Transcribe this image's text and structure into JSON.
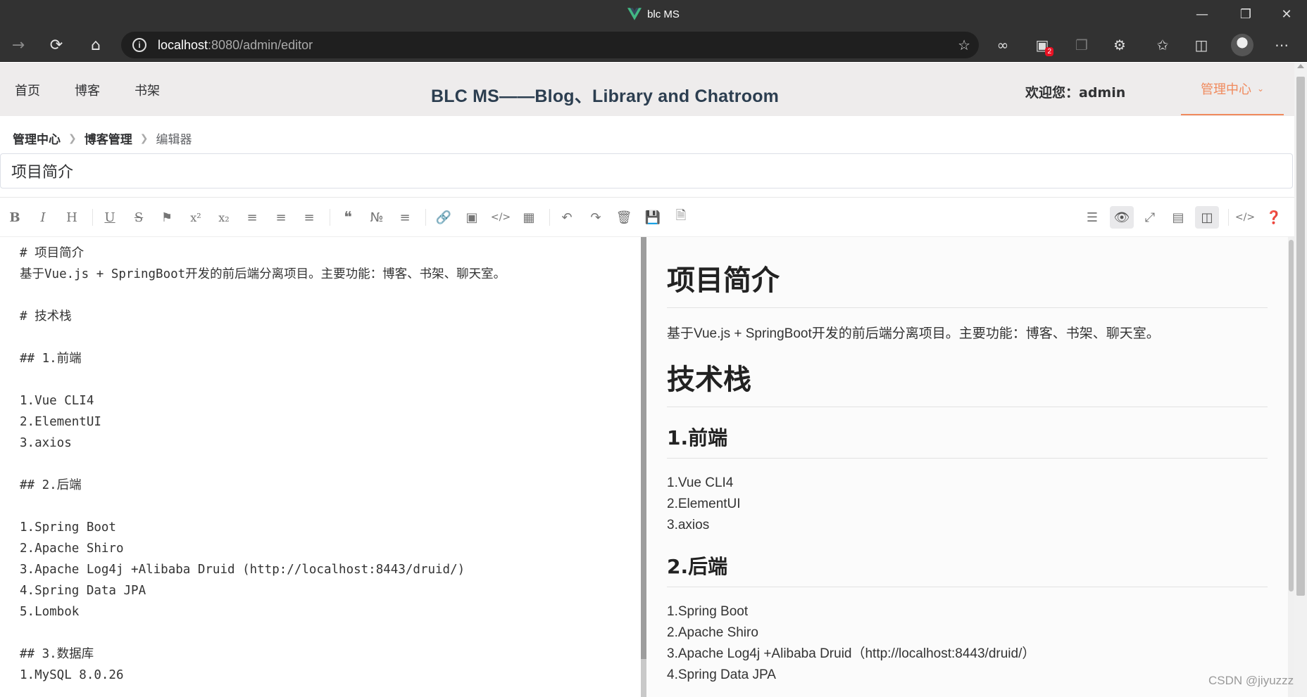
{
  "browser": {
    "window_title": "blc MS",
    "url_host": "localhost",
    "url_rest": ":8080/admin/editor",
    "extension_badge": "2",
    "accent": "#42b883"
  },
  "header": {
    "nav": [
      "首页",
      "博客",
      "书架"
    ],
    "title": "BLC MS——Blog、Library and Chatroom",
    "welcome": "欢迎您：admin",
    "admin_menu": "管理中心",
    "accent": "#f08a5d"
  },
  "breadcrumb": [
    "管理中心",
    "博客管理",
    "编辑器"
  ],
  "article": {
    "title": "项目简介"
  },
  "editor": {
    "source_lines": [
      "# 项目简介",
      "基于Vue.js + SpringBoot开发的前后端分离项目。主要功能：博客、书架、聊天室。",
      "",
      "# 技术栈",
      "",
      "## 1.前端",
      "",
      "1.Vue CLI4",
      "2.ElementUI",
      "3.axios",
      "",
      "## 2.后端",
      "",
      "1.Spring Boot",
      "2.Apache Shiro",
      "3.Apache Log4j +Alibaba Druid (http://localhost:8443/druid/)",
      "4.Spring Data JPA",
      "5.Lombok",
      "",
      "## 3.数据库",
      "1.MySQL 8.0.26"
    ],
    "preview": {
      "h1_intro": "项目简介",
      "intro_text": "基于Vue.js + SpringBoot开发的前后端分离项目。主要功能：博客、书架、聊天室。",
      "h1_stack": "技术栈",
      "h2_front": "1.前端",
      "front_items": [
        "1.Vue CLI4",
        "2.ElementUI",
        "3.axios"
      ],
      "h2_back": "2.后端",
      "back_items": [
        "1.Spring Boot",
        "2.Apache Shiro",
        "3.Apache Log4j +Alibaba Druid（http://localhost:8443/druid/）",
        "4.Spring Data JPA"
      ]
    }
  },
  "watermark": "CSDN @jiyuzzz"
}
